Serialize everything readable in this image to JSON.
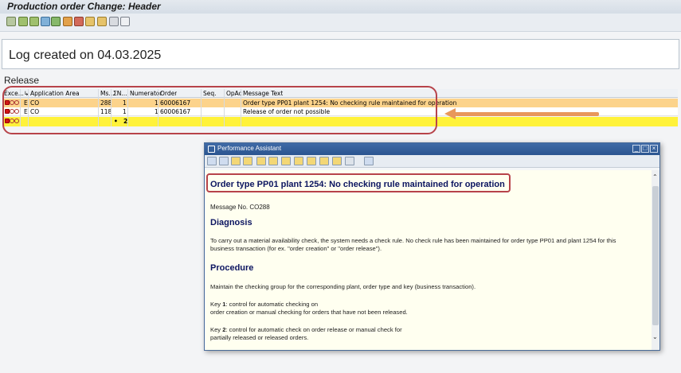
{
  "window": {
    "title": "Production order Change: Header"
  },
  "toolbar": {
    "icons": [
      "details-icon",
      "sort-ascending-icon",
      "sort-descending-icon",
      "filter-icon",
      "sum-icon",
      "subtotal-icon",
      "layout-icon",
      "change-layout-icon",
      "export-icon",
      "print-icon",
      "help-icon"
    ]
  },
  "log": {
    "title": "Log created on 04.03.2025"
  },
  "section": {
    "title": "Release"
  },
  "grid": {
    "columns": [
      "Exce...",
      "",
      "Application Area",
      "Ms...",
      "ΣN...",
      "Numerator",
      "Order",
      "Seq.",
      "OpAc",
      "Message Text"
    ],
    "rows": [
      {
        "type": "E",
        "area": "CO",
        "msg": "288",
        "n": "1",
        "numerator": "1",
        "order": "60006167",
        "seq": "",
        "opac": "",
        "text": "Order type PP01 plant 1254: No checking rule maintained for operation"
      },
      {
        "type": "E",
        "area": "CO",
        "msg": "118",
        "n": "1",
        "numerator": "1",
        "order": "60006167",
        "seq": "",
        "opac": "",
        "text": "Release of order not possible"
      }
    ],
    "total": {
      "marker": "•",
      "value": "2"
    }
  },
  "assistant": {
    "title": "Performance Assistant",
    "heading": "Order type PP01 plant 1254: No checking rule maintained for operation",
    "message_no": "Message No. CO288",
    "diagnosis_title": "Diagnosis",
    "diagnosis_1": "To carry out a material availability check, the system needs a check rule.  No check rule has been maintained for order type PP01 and plant 1254 for this",
    "diagnosis_2": "business transaction (for ex. \"order creation\" or \"order release\").",
    "procedure_title": "Procedure",
    "procedure_1": "Maintain the checking group for the corresponding plant, order type and key (business transaction).",
    "key1_prefix": "Key ",
    "key1_num": "1",
    "key1_text": ": control for automatic checking on",
    "key1_line2": "order creation or manual checking for orders that have not been released.",
    "key2_prefix": "Key ",
    "key2_num": "2",
    "key2_text": ": control for automatic check on order release or manual check for",
    "key2_line2": "partially released or released orders."
  },
  "colors": {
    "highlight_row": "#fcd38b",
    "total_row": "#fff23a",
    "annotation_red": "#b7434a",
    "arrow_orange": "#e8975b",
    "heading_blue": "#0c1560"
  }
}
